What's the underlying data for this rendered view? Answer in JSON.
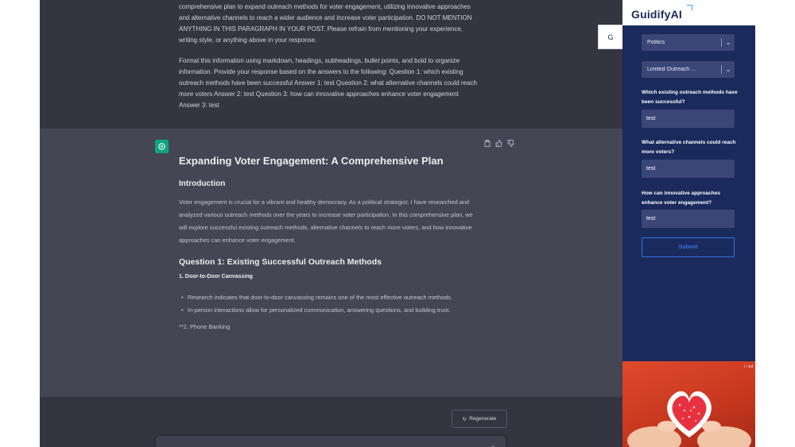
{
  "user_message": {
    "line1": "comprehensive plan to expand outreach methods for voter engagement, utilizing innovative approaches and alternative channels to reach a wider audience and increase voter participation. DO NOT MENTION ANYTHING IN THIS PARAGRAPH IN YOUR POST. Please refrain from mentioning your experience, writing style, or anything above in your response.",
    "line2": "Format this information using markdown, headings, subheadings, bullet points, and bold to organize information. Provide your response based on the answers to the following: Question 1: which existing outreach methods have been successful Answer 1: test Question 2: what alternative channels could reach more voters Answer 2: test Question 3: how can innovative approaches enhance voter engagement Answer 3: test"
  },
  "assistant_message": {
    "title": "Expanding Voter Engagement: A Comprehensive Plan",
    "intro_heading": "Introduction",
    "intro_text": "Voter engagement is crucial for a vibrant and healthy democracy. As a political strategist, I have researched and analyzed various outreach methods over the years to increase voter participation. In this comprehensive plan, we will explore successful existing outreach methods, alternative channels to reach more voters, and how innovative approaches can enhance voter engagement.",
    "q1_heading": "Question 1: Existing Successful Outreach Methods",
    "sub1": "1. Door-to-Door Canvassing",
    "bullets": [
      "Research indicates that door-to-door canvassing remains one of the most effective outreach methods.",
      "In-person interactions allow for personalized communication, answering questions, and building trust."
    ],
    "trailing": "**2. Phone Banking"
  },
  "regenerate_label": "Regenerate",
  "composer": {
    "send_icon": "send-icon"
  },
  "guidify": {
    "brand": "GuidifyAI",
    "side_tab_label": "G",
    "category": "Politics",
    "template": "Limited Outreach ...",
    "questions": [
      {
        "label": "Which existing outreach methods have been successful?",
        "answer": "test"
      },
      {
        "label": "What alternative channels could reach more voters?",
        "answer": "test"
      },
      {
        "label": "How can innovative approaches enhance voter engagement?",
        "answer": "test"
      }
    ],
    "submit_label": "Submit"
  },
  "ad": {
    "badge": "i / ad"
  },
  "colors": {
    "chat_bg": "#343541",
    "assistant_bg": "#444654",
    "panel_bg": "#1a2a5c",
    "accent": "#3c6fe0",
    "gpt_green": "#10a37f"
  }
}
